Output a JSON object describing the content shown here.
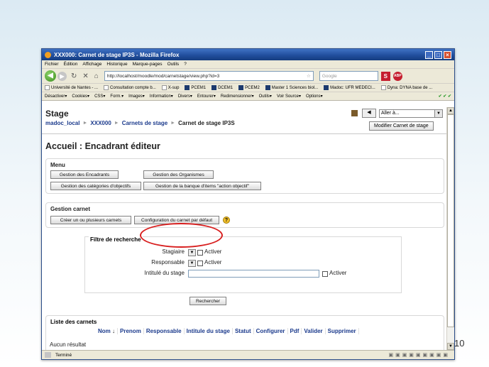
{
  "browser": {
    "title": "XXX000: Carnet de stage IP3S - Mozilla Firefox",
    "menu": [
      "Fichier",
      "Édition",
      "Affichage",
      "Historique",
      "Marque-pages",
      "Outils",
      "?"
    ],
    "url": "http://localhost/moodle/mod/carnetstage/view.php?id=3",
    "search_placeholder": "Google",
    "bookmarks": [
      "Université de Nantes - ...",
      "Consultation compte b...",
      "X-sup",
      "PCEM1",
      "DCEM1",
      "PCEM2",
      "Master 1 Sciences biol...",
      "Madoc: UFR MEDECI...",
      "Dyna: DYNA base de ..."
    ],
    "devtools": [
      "Désactiver▾",
      "Cookies▾",
      "CSS▾",
      "Form.▾",
      "Images▾",
      "Information▾",
      "Divers▾",
      "Entourer▾",
      "Redimensionner▾",
      "Outils▾",
      "Voir Source▾",
      "Options▾"
    ],
    "status": "Terminé"
  },
  "page": {
    "course_title": "Stage",
    "jump_placeholder": "Aller à...",
    "breadcrumb": [
      "madoc_local",
      "XXX000",
      "Carnets de stage",
      "Carnet de stage IP3S"
    ],
    "modify_button": "Modifier Carnet de stage",
    "heading": "Accueil : Encadrant éditeur",
    "menu_section": {
      "title": "Menu",
      "btn_encadrants": "Gestion des Encadrants",
      "btn_organismes": "Gestion des Organismes",
      "btn_categories": "Gestion des catégories d'objectifs",
      "btn_banque": "Gestion de la banque d'items \"action objectif\""
    },
    "carnet_section": {
      "title": "Gestion carnet",
      "btn_create": "Créer un ou plusieurs carnets",
      "btn_config": "Configuration du carnet par défaut"
    },
    "filter": {
      "legend": "Filtre de recherche",
      "stagiaire_label": "Stagiaire",
      "responsable_label": "Responsable",
      "intitule_label": "Intitulé du stage",
      "activate_label": "Activer",
      "search_button": "Rechercher"
    },
    "list": {
      "title": "Liste des carnets",
      "columns": [
        "Nom",
        "Prenom",
        "Responsable",
        "Intitule du stage",
        "Statut",
        "Configurer",
        "Pdf",
        "Valider",
        "Supprimer"
      ],
      "sort_arrow": "↓",
      "empty_text": "Aucun résultat"
    }
  },
  "slide_number": "10",
  "colors": {
    "highlight_circle": "#d81f1f",
    "link": "#1b3a8c"
  }
}
